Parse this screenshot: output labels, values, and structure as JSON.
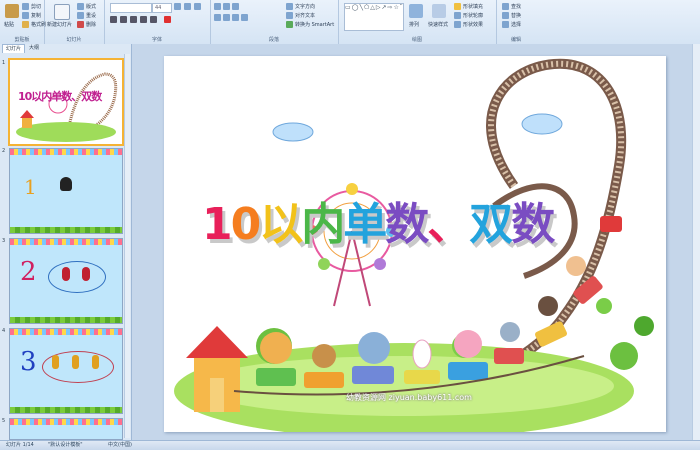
{
  "ribbon": {
    "clipboard": {
      "paste": "粘贴",
      "cut": "剪切",
      "copy": "复制",
      "format_painter": "格式刷",
      "label": "剪贴板"
    },
    "slides": {
      "new_slide": "新建幻灯片",
      "layout": "版式",
      "reset": "重设",
      "delete": "删除",
      "label": "幻灯片"
    },
    "font": {
      "size": "44",
      "label": "字体"
    },
    "paragraph": {
      "text_direction": "文字方向",
      "align_text": "对齐文本",
      "smartart": "转换为 SmartArt",
      "label": "段落"
    },
    "drawing": {
      "arrange": "排列",
      "quick_styles": "快速样式",
      "shape_fill": "形状填充",
      "shape_outline": "形状轮廓",
      "shape_effects": "形状效果",
      "label": "绘图"
    },
    "editing": {
      "find": "查找",
      "replace": "替换",
      "select": "选择",
      "label": "编辑"
    }
  },
  "panes": {
    "tab_slides": "幻灯片",
    "tab_outline": "大纲"
  },
  "thumbnails": [
    {
      "num": "1",
      "title": "10以内单数、双数"
    },
    {
      "num": "2",
      "digit": "1"
    },
    {
      "num": "3",
      "digit": "2"
    },
    {
      "num": "4",
      "digit": "3"
    },
    {
      "num": "5"
    }
  ],
  "slide": {
    "title": "10以内单数、双数",
    "watermark": "幼教资源网 ziyuan.baby611.com",
    "title_colors": [
      "#e8205a",
      "#f57d1f",
      "#f2c21a",
      "#4bb748",
      "#23a3dd",
      "#7a4cc2",
      "#e8205a",
      "#23a3dd",
      "#7a4cc2"
    ]
  },
  "status": {
    "slide_count": "幻灯片 1/14",
    "theme": "\"默认设计模板\"",
    "language": "中文(中国)"
  }
}
